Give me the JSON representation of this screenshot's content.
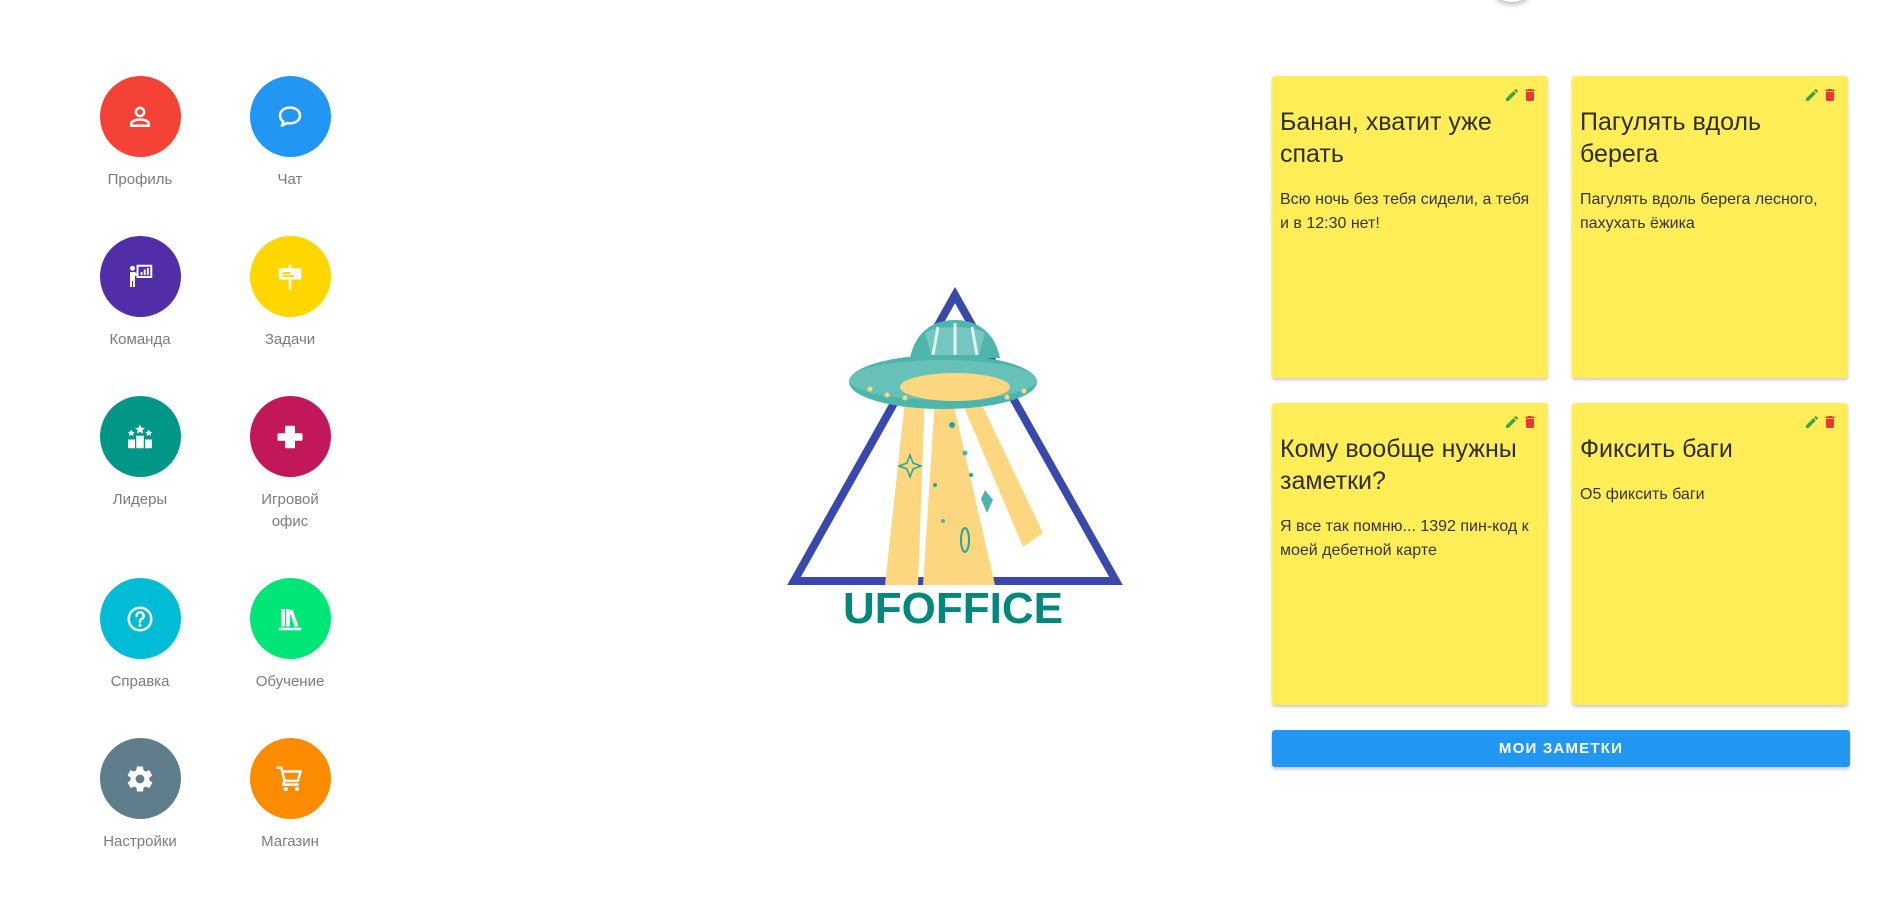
{
  "nav": {
    "items": [
      {
        "label": "Профиль",
        "icon": "person-icon",
        "color": "#f44336"
      },
      {
        "label": "Чат",
        "icon": "chat-bubble-icon",
        "color": "#2196f3"
      },
      {
        "label": "Команда",
        "icon": "presenter-icon",
        "color": "#512da8"
      },
      {
        "label": "Задачи",
        "icon": "signboard-icon",
        "color": "#ffd600"
      },
      {
        "label": "Лидеры",
        "icon": "leaderboard-icon",
        "color": "#009688"
      },
      {
        "label": "Игровой офис",
        "icon": "gamepad-icon",
        "color": "#c2185b"
      },
      {
        "label": "Справка",
        "icon": "help-icon",
        "color": "#00bcd4"
      },
      {
        "label": "Обучение",
        "icon": "books-icon",
        "color": "#00e676"
      },
      {
        "label": "Настройки",
        "icon": "gear-icon",
        "color": "#607d8b"
      },
      {
        "label": "Магазин",
        "icon": "shopping-cart-icon",
        "color": "#fb8c00"
      }
    ]
  },
  "logo": {
    "text": "UFOFFICE",
    "text_color": "#00897b",
    "triangle_color": "#3949ab",
    "beam_color": "#fcd77f",
    "ufo_color": "#4db6ac"
  },
  "notes": {
    "background": "#ffee58",
    "edit_icon_color": "#43a047",
    "delete_icon_color": "#e53935",
    "items": [
      {
        "title": "Банан, хватит уже спать",
        "body": "Всю ночь без тебя сидели, а тебя и в 12:30 нет!"
      },
      {
        "title": "Пагулять вдоль берега",
        "body": "Пагулять вдоль берега лесного, пахухать ёжика"
      },
      {
        "title": "Кому вообще нужны заметки?",
        "body": "Я все так помню... 1392 пин-код к моей дебетной карте"
      },
      {
        "title": "Фиксить баги",
        "body": "О5 фиксить баги"
      }
    ],
    "button_label": "МОИ ЗАМЕТКИ"
  }
}
